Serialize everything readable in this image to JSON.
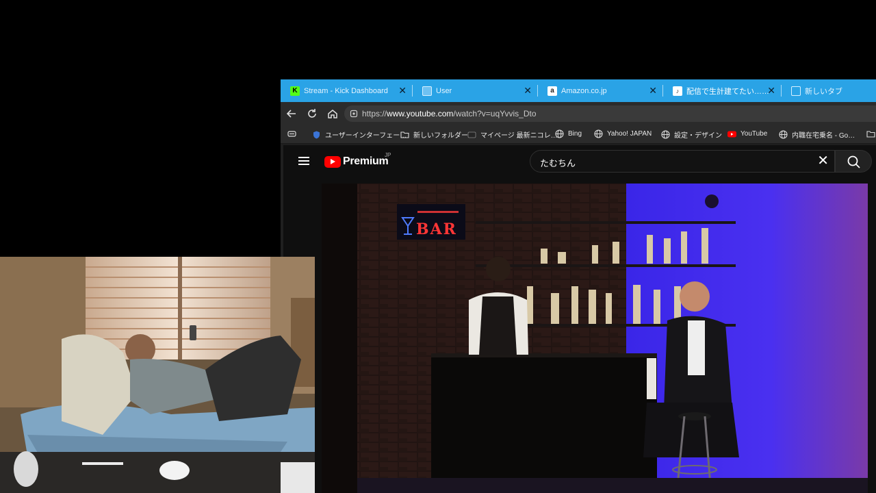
{
  "tabs": [
    {
      "title": "Stream - Kick Dashboard",
      "favicon": "kick-icon",
      "color": "#53fc18"
    },
    {
      "title": "User",
      "favicon": "user-page-icon",
      "color": "#6ec1f2"
    },
    {
      "title": "Amazon.co.jp",
      "favicon": "amazon-icon",
      "color": "#ffffff"
    },
    {
      "title": "配信で生計建てたい…わかってん",
      "favicon": "audio-page-icon",
      "color": "#ffffff"
    },
    {
      "title": "新しいタブ",
      "favicon": "new-tab-icon",
      "color": "#ffffff"
    }
  ],
  "address": {
    "prefix": "https://",
    "domain": "www.youtube.com",
    "path": "/watch?v=uqYvvis_Dto"
  },
  "bookmarks": [
    {
      "label": "ユーザーインターフェー…",
      "icon": "shield-icon"
    },
    {
      "label": "新しいフォルダー",
      "icon": "folder-icon"
    },
    {
      "label": "マイページ 最新ニコレ…",
      "icon": "niconico-icon"
    },
    {
      "label": "Bing",
      "icon": "globe-icon"
    },
    {
      "label": "Yahoo! JAPAN",
      "icon": "globe-icon"
    },
    {
      "label": "設定・デザイン",
      "icon": "globe-icon"
    },
    {
      "label": "YouTube",
      "icon": "youtube-icon"
    },
    {
      "label": "内職在宅乗名 - Go…",
      "icon": "globe-icon"
    }
  ],
  "youtube": {
    "brand": "Premium",
    "region": "JP",
    "search_query": "たむちん"
  },
  "video": {
    "neon_sign": "BAR"
  },
  "colors": {
    "tabbar": "#2aa3e6",
    "youtube_red": "#ff0000",
    "stage_purple": "#4a2cf0"
  }
}
